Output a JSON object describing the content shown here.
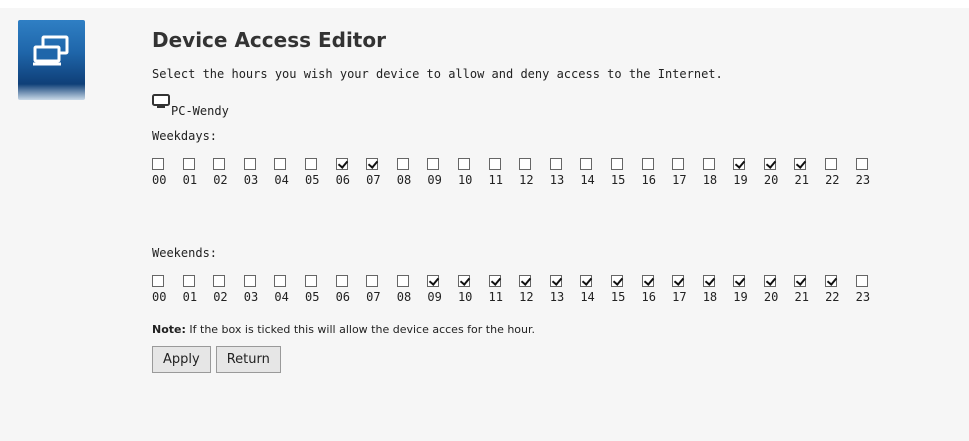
{
  "page": {
    "title": "Device Access Editor",
    "description": "Select the hours you wish your device to allow and deny access to the Internet."
  },
  "device": {
    "icon": "monitor-icon",
    "name": "PC-Wendy"
  },
  "weekdays": {
    "label": "Weekdays:",
    "hours": [
      {
        "hour": "00",
        "checked": false
      },
      {
        "hour": "01",
        "checked": false
      },
      {
        "hour": "02",
        "checked": false
      },
      {
        "hour": "03",
        "checked": false
      },
      {
        "hour": "04",
        "checked": false
      },
      {
        "hour": "05",
        "checked": false
      },
      {
        "hour": "06",
        "checked": true
      },
      {
        "hour": "07",
        "checked": true
      },
      {
        "hour": "08",
        "checked": false
      },
      {
        "hour": "09",
        "checked": false
      },
      {
        "hour": "10",
        "checked": false
      },
      {
        "hour": "11",
        "checked": false
      },
      {
        "hour": "12",
        "checked": false
      },
      {
        "hour": "13",
        "checked": false
      },
      {
        "hour": "14",
        "checked": false
      },
      {
        "hour": "15",
        "checked": false
      },
      {
        "hour": "16",
        "checked": false
      },
      {
        "hour": "17",
        "checked": false
      },
      {
        "hour": "18",
        "checked": false
      },
      {
        "hour": "19",
        "checked": true
      },
      {
        "hour": "20",
        "checked": true
      },
      {
        "hour": "21",
        "checked": true
      },
      {
        "hour": "22",
        "checked": false
      },
      {
        "hour": "23",
        "checked": false
      }
    ]
  },
  "weekends": {
    "label": "Weekends:",
    "hours": [
      {
        "hour": "00",
        "checked": false
      },
      {
        "hour": "01",
        "checked": false
      },
      {
        "hour": "02",
        "checked": false
      },
      {
        "hour": "03",
        "checked": false
      },
      {
        "hour": "04",
        "checked": false
      },
      {
        "hour": "05",
        "checked": false
      },
      {
        "hour": "06",
        "checked": false
      },
      {
        "hour": "07",
        "checked": false
      },
      {
        "hour": "08",
        "checked": false
      },
      {
        "hour": "09",
        "checked": true
      },
      {
        "hour": "10",
        "checked": true
      },
      {
        "hour": "11",
        "checked": true
      },
      {
        "hour": "12",
        "checked": true
      },
      {
        "hour": "13",
        "checked": true
      },
      {
        "hour": "14",
        "checked": true
      },
      {
        "hour": "15",
        "checked": true
      },
      {
        "hour": "16",
        "checked": true
      },
      {
        "hour": "17",
        "checked": true
      },
      {
        "hour": "18",
        "checked": true
      },
      {
        "hour": "19",
        "checked": true
      },
      {
        "hour": "20",
        "checked": true
      },
      {
        "hour": "21",
        "checked": true
      },
      {
        "hour": "22",
        "checked": true
      },
      {
        "hour": "23",
        "checked": false
      }
    ]
  },
  "note": {
    "label": "Note:",
    "text": " If the box is ticked this will allow the device acces for the hour."
  },
  "buttons": {
    "apply": "Apply",
    "return": "Return"
  },
  "colors": {
    "icon_gradient_top": "#2f7fc4",
    "icon_gradient_bottom": "#0f3f78"
  }
}
